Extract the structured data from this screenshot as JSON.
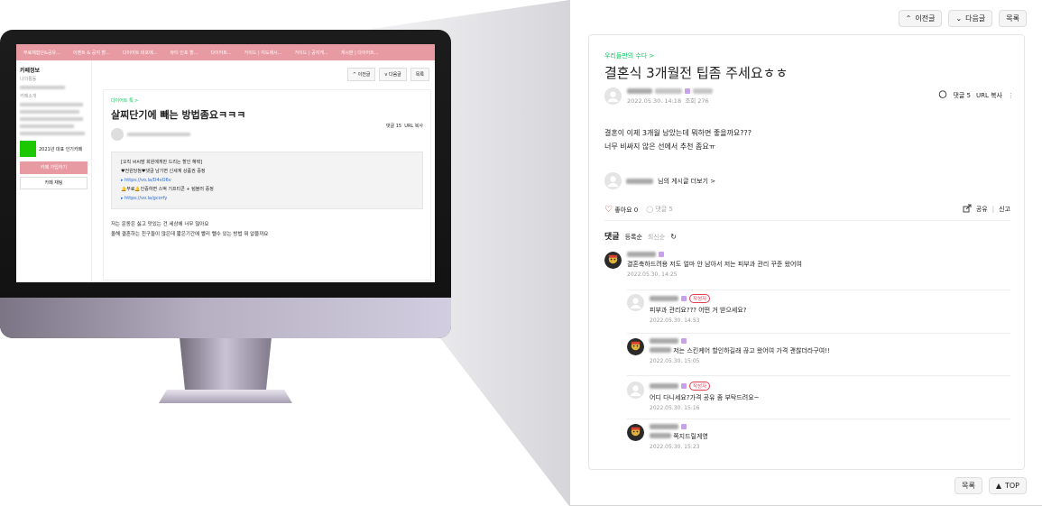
{
  "monitor_screen": {
    "nav_items": [
      "무료체험단&공유...",
      "이벤트 & 공지 할...",
      "다이어트 비포에...",
      "뷰티 인포 할...",
      "다이어트...",
      "가이드 | 지도제시...",
      "가이드 | 공지게...",
      "게시판 | 다이어트..."
    ],
    "cafe_label": "카페정보",
    "my_activity": "나의활동",
    "cafe_intro": "카페소개",
    "popular_cafe": "2021년 대표 인기카페",
    "naver_badge": "NAVER 대표카페",
    "join_button": "카페 가입하기",
    "chat_button": "카페 채팅",
    "prev_button": "이전글",
    "next_button": "다음글",
    "list_button": "목록",
    "board_name": "다이어트 톡 >",
    "post_title": "살찌단기에 빼는 방법좀요ㅋㅋㅋ",
    "comment_count": "댓글 15",
    "url_copy": "URL 복사",
    "notice_lines": [
      "[오직 씨씨맘 회원에게만 드리는 할인 혜택]",
      "♥전원당첨♥댓글 남기면 신세계 상품권 증정",
      "▸ https://vo.la/D4vO6v",
      "🔔무료🔔인증하면 스벅 기프티콘 + 텀블러 증정",
      "▸ https://vo.la/gcorfy"
    ],
    "body_lines": [
      "저는 운동은 싫고 맛있는 건 세상에 너무 많아요",
      "올해 결혼하는 친구들이 많은데 짧은기간에 빨리 뺄수 있는 방법 뭐 없을까요"
    ]
  },
  "panel": {
    "prev_button": "이전글",
    "next_button": "다음글",
    "list_button": "목록",
    "top_button": "TOP",
    "board_name": "우리들만의 수다 >",
    "title": "결혼식 3개월전 팁좀 주세요ㅎㅎ",
    "post_date": "2022.05.30. 14:18",
    "views": "조회 276",
    "comment_count": "댓글 5",
    "url_copy": "URL 복사",
    "content": [
      "결혼이 이제 3개월 남았는데 뭐하면 좋을까요???",
      "너무 비싸지 않은 선에서 추천 좀요ㅠ"
    ],
    "more_posts_suffix": "님의 게시글 더보기 >",
    "like_label": "좋아요 0",
    "comment_label": "댓글 5",
    "share_label": "공유",
    "report_label": "신고",
    "comments_heading": "댓글",
    "sort_registered": "등록순",
    "sort_latest": "최신순",
    "writer_badge": "작성자",
    "comments": [
      {
        "text": "결혼축하드려용 저도 얼마 안 남아서 저는 피부과 관리 꾸준 왔어여",
        "date": "2022.05.30. 14:25",
        "reply": false,
        "writer": false,
        "avatar": "character"
      },
      {
        "text": "피부과 관리요??? 어떤 거 받으세요?",
        "date": "2022.05.30. 14:53",
        "reply": true,
        "writer": true,
        "avatar": "default"
      },
      {
        "text": "저는 스킨케어 할인하길래 끊고 왔어여 가격 괜찮더라구여!!",
        "date": "2022.05.30. 15:05",
        "reply": true,
        "writer": false,
        "avatar": "character"
      },
      {
        "text": "어디 다니세요?가격 공유 좀 부탁드려요~",
        "date": "2022.05.30. 15:16",
        "reply": true,
        "writer": true,
        "avatar": "default"
      },
      {
        "text": "쪽지드릴게영",
        "date": "2022.05.30. 15:23",
        "reply": true,
        "writer": false,
        "avatar": "character"
      }
    ]
  },
  "colors": {
    "accent_green": "#03c75a",
    "nav_pink": "#e89aa3",
    "like_red": "#e02020",
    "writer_red": "#e04050"
  }
}
